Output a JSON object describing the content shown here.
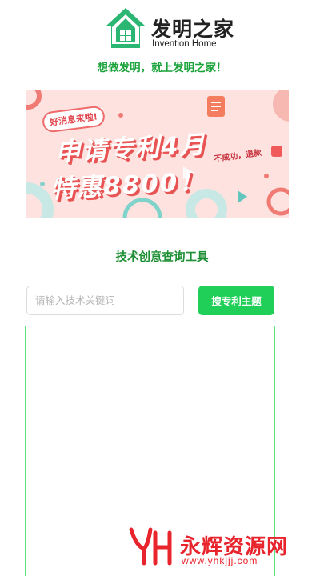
{
  "header": {
    "logo_cn": "发明之家",
    "logo_en": "Invention Home",
    "slogan": "想做发明，就上发明之家！"
  },
  "banner": {
    "tag": "好消息来啦!",
    "line1": "申请专利4月",
    "line2": "特惠8800！",
    "note": "不成功，退款"
  },
  "tool": {
    "title": "技术创意查询工具",
    "search_placeholder": "请输入技术关键词",
    "search_value": "",
    "search_button": "搜专利主题"
  },
  "watermark": {
    "text": "永辉资源网",
    "url": "www.yhkjjj.com"
  },
  "colors": {
    "brand_green": "#1aa33a",
    "button_green": "#1fcf58",
    "result_border": "#56e37f",
    "banner_bg": "#fde2df",
    "watermark_red": "#e8242c"
  }
}
